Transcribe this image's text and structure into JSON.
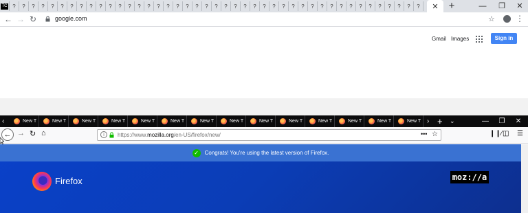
{
  "chrome": {
    "tab_favicon_glyph": "?",
    "active_tab_favicon": "TC",
    "close_tab": "✕",
    "new_tab": "+",
    "window_controls": [
      "—",
      "❐",
      "✕"
    ],
    "url": "google.com",
    "google": {
      "gmail": "Gmail",
      "images": "Images",
      "sign_in": "Sign in"
    }
  },
  "firefox": {
    "tab_label": "New T",
    "tab_count": 14,
    "url_prefix": "https://www.",
    "url_domain": "mozilla.org",
    "url_suffix": "/en-US/firefox/new/",
    "notice": "Congrats! You're using the latest version of Firefox.",
    "brand": "Firefox",
    "logo_text": "moz://a"
  },
  "colors": {
    "chrome_tabstrip": "#dee1e6",
    "google_blue": "#4285f4",
    "firefox_dark": "#0c0c0d",
    "mozilla_blue": "#0a41c9",
    "notice_bar": "#3a72d2",
    "check_green": "#12bc00"
  }
}
